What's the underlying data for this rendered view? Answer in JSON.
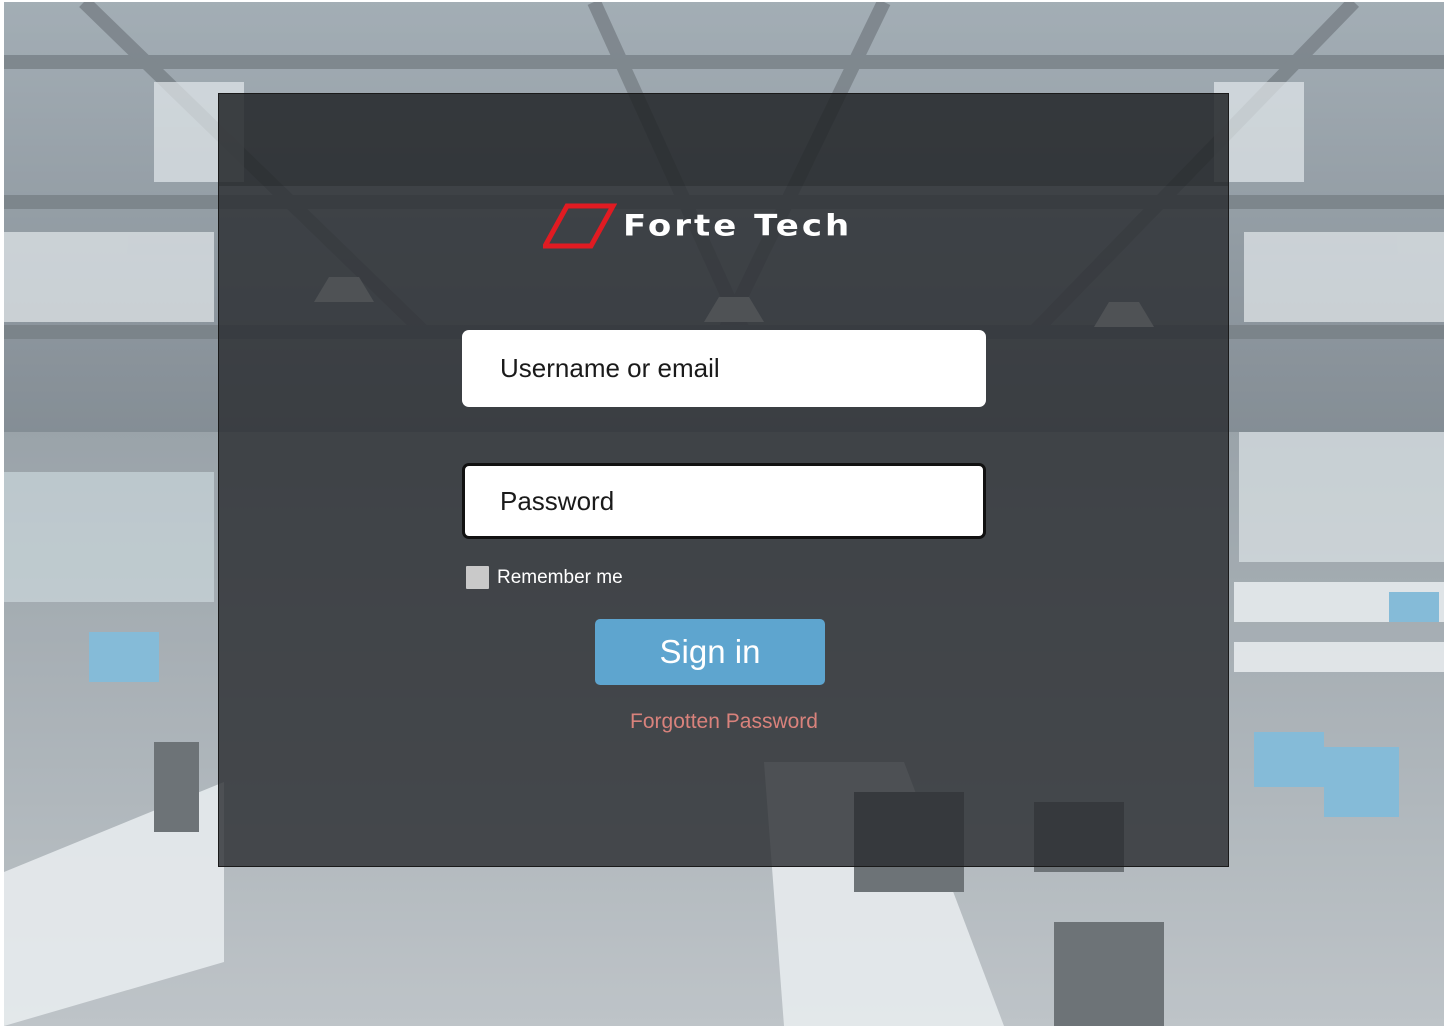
{
  "app": {
    "brand_name": "Forte Tech",
    "logo_icon": "parallelogram-logo-icon"
  },
  "login_form": {
    "username_placeholder": "Username or email",
    "password_placeholder": "Password",
    "remember_label": "Remember me",
    "remember_checked": false,
    "signin_label": "Sign in",
    "forgot_label": "Forgotten Password"
  },
  "colors": {
    "accent_button": "#5ea5cf",
    "link": "#d9827c",
    "logo_mark": "#e11b22",
    "panel_bg": "#282a2e"
  }
}
